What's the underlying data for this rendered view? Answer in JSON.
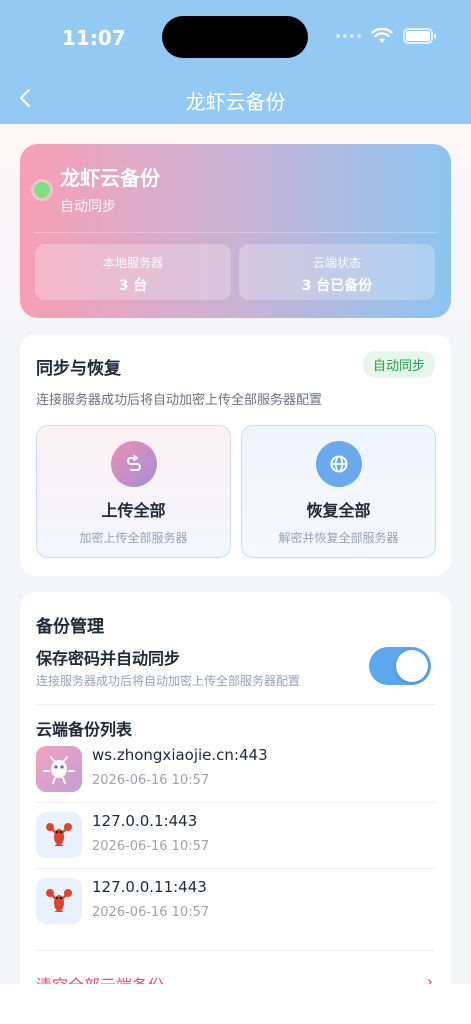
{
  "status_bar": {
    "time": "11:07"
  },
  "nav": {
    "title": "龙虾云备份"
  },
  "hero": {
    "title": "龙虾云备份",
    "subtitle": "自动同步",
    "stats": [
      {
        "label": "本地服务器",
        "value": "3 台"
      },
      {
        "label": "云端状态",
        "value": "3 台已备份"
      }
    ]
  },
  "sync": {
    "title": "同步与恢复",
    "badge": "自动同步",
    "description": "连接服务器成功后将自动加密上传全部服务器配置",
    "actions": [
      {
        "title": "上传全部",
        "subtitle": "加密上传全部服务器",
        "icon": "upload-link-icon"
      },
      {
        "title": "恢复全部",
        "subtitle": "解密并恢复全部服务器",
        "icon": "globe-icon"
      }
    ]
  },
  "backup": {
    "title": "备份管理",
    "option_title": "保存密码并自动同步",
    "option_desc": "连接服务器成功后将自动加密上传全部服务器配置",
    "toggle_on": true,
    "list_title": "云端备份列表",
    "items": [
      {
        "host": "ws.zhongxiaojie.cn:443",
        "time": "2026-06-16 10:57",
        "avatar": "mascot-avatar"
      },
      {
        "host": "127.0.0.1:443",
        "time": "2026-06-16 10:57",
        "avatar": "lobster-icon"
      },
      {
        "host": "127.0.0.11:443",
        "time": "2026-06-16 10:57",
        "avatar": "lobster-icon"
      }
    ],
    "danger_label": "清空全部云端备份"
  },
  "colors": {
    "header": "#93c9f2",
    "accent": "#5ba6ec",
    "success": "#1e9f4a",
    "danger": "#ef4b6d"
  }
}
